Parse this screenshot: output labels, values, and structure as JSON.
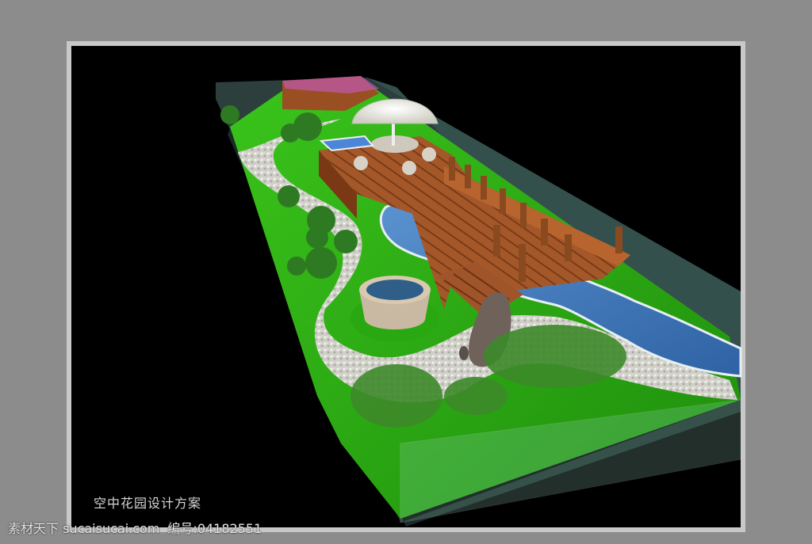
{
  "caption": "空中花园设计方案",
  "watermark": {
    "site": "素材天下 sucaisucai.com",
    "id_label": "编号:",
    "id_value": "04182551"
  },
  "colors": {
    "background": "#8c8c8c",
    "canvas": "#000000",
    "grass": "#2fae14",
    "deck": "#9a4f22",
    "water": "#3f7fc0",
    "gravel": "#d8d8d0",
    "wall": "#3c5552"
  }
}
